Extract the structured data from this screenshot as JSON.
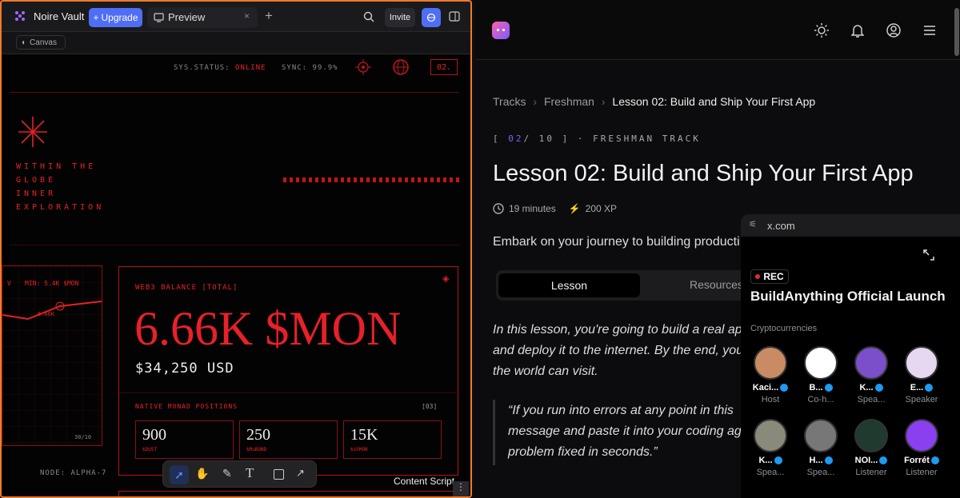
{
  "left_app": {
    "title": "Noire Vault",
    "upgrade_label": "Upgrade",
    "preview_tab": "Preview",
    "invite_label": "Invite",
    "canvas_label": "Canvas",
    "page": {
      "sys_status_label": "SYS.STATUS:",
      "sys_status_value": "ONLINE",
      "sync_label": "SYNC: 99.9%",
      "index_badge": "02.",
      "hero_lines": [
        "WITHIN THE",
        "GLOBE",
        "INNER",
        "EXPLORATION"
      ],
      "mini_chart_label": "MIN: 5.4K $MON",
      "mini_chart_point": "6.66K",
      "mini_chart_counter": "30/10",
      "node_label": "NODE: ALPHA-7",
      "balance_label": "WEB3 BALANCE [TOTAL]",
      "balance_value": "6.66K $MON",
      "balance_usd": "$34,250 USD",
      "positions_label": "NATIVE MONAD POSITIONS",
      "positions_count": "[03]",
      "positions": [
        {
          "value": "900",
          "token": "$DUST"
        },
        {
          "value": "250",
          "token": "$MuBOND"
        },
        {
          "value": "15K",
          "token": "$shMON"
        }
      ]
    },
    "content_script_label": "Content Script"
  },
  "lesson": {
    "breadcrumb": [
      "Tracks",
      "Freshman",
      "Lesson 02: Build and Ship Your First App"
    ],
    "track_number": "02",
    "track_total": "/ 10 ]",
    "track_open": "[",
    "track_name": "· FRESHMAN TRACK",
    "title": "Lesson 02: Build and Ship Your First App",
    "duration": "19 minutes",
    "xp": "200 XP",
    "intro": "Embark on your journey to building producti",
    "tabs": [
      "Lesson",
      "Resources"
    ],
    "body_lines": [
      "In this lesson, you're going to build a real ap",
      "and deploy it to the internet. By the end, you",
      "the world can visit."
    ],
    "quote_lines": [
      "“If you run into errors at any point in this",
      "message and paste it into your coding ag",
      "problem fixed in seconds.”"
    ]
  },
  "x_space": {
    "url": "x.com",
    "rec_label": "REC",
    "title": "BuildAnything Official Launch",
    "category": "Cryptocurrencies",
    "speakers": [
      {
        "name": "Kaci...",
        "role": "Host",
        "avatar_color": "#c98b63"
      },
      {
        "name": "B...",
        "role": "Co-h...",
        "avatar_color": "#ffffff"
      },
      {
        "name": "K...",
        "role": "Spea...",
        "avatar_color": "#7b4fc9"
      },
      {
        "name": "E...",
        "role": "Speaker",
        "avatar_color": "#e7d8f2"
      },
      {
        "name": "K...",
        "role": "Spea...",
        "avatar_color": "#8a8a7a"
      },
      {
        "name": "H...",
        "role": "Spea...",
        "avatar_color": "#777777"
      },
      {
        "name": "NOI...",
        "role": "Listener",
        "avatar_color": "#1f3a2e"
      },
      {
        "name": "Forrét",
        "role": "Listener",
        "avatar_color": "#8a3ff0"
      }
    ]
  },
  "colors": {
    "accent_red": "#e8202a",
    "accent_blue": "#4f6df5",
    "track_purple": "#8a5cf6"
  }
}
